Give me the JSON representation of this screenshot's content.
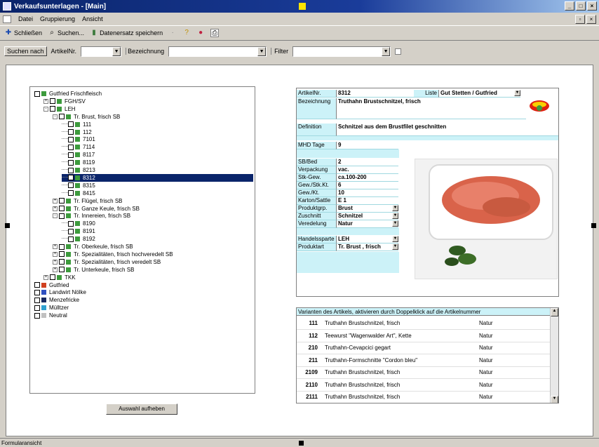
{
  "window": {
    "title": "Verkaufsunterlagen - [Main]"
  },
  "menu": {
    "items": [
      "Datei",
      "Gruppierung",
      "Ansicht"
    ]
  },
  "toolbar": {
    "close": "Schließen",
    "search": "Suchen...",
    "save": "Datenersatz speichern"
  },
  "searchbar": {
    "search_by": "Suchen nach",
    "artnr_label": "ArtikelNr.",
    "artnr_value": "",
    "bez_label": "Bezeichnung",
    "bez_value": "",
    "filter_label": "Filter",
    "filter_value": ""
  },
  "tree": {
    "nodes": [
      {
        "label": "Gutfried Frischfleisch",
        "color": "#3c9a3c",
        "level": 0,
        "expander": ""
      },
      {
        "label": "FGH/SV",
        "color": "#3c9a3c",
        "level": 1,
        "expander": "+"
      },
      {
        "label": "LEH",
        "color": "#3c9a3c",
        "level": 1,
        "expander": "-"
      },
      {
        "label": "Tr. Brust, frisch SB",
        "color": "#3c9a3c",
        "level": 2,
        "expander": "-"
      },
      {
        "label": "111",
        "color": "#3c9a3c",
        "level": 3,
        "expander": ""
      },
      {
        "label": "112",
        "color": "#3c9a3c",
        "level": 3,
        "expander": ""
      },
      {
        "label": "7101",
        "color": "#3c9a3c",
        "level": 3,
        "expander": ""
      },
      {
        "label": "7114",
        "color": "#3c9a3c",
        "level": 3,
        "expander": ""
      },
      {
        "label": "8117",
        "color": "#3c9a3c",
        "level": 3,
        "expander": ""
      },
      {
        "label": "8119",
        "color": "#3c9a3c",
        "level": 3,
        "expander": ""
      },
      {
        "label": "8213",
        "color": "#3c9a3c",
        "level": 3,
        "expander": ""
      },
      {
        "label": "8312",
        "color": "#3c9a3c",
        "level": 3,
        "expander": "",
        "selected": true
      },
      {
        "label": "8315",
        "color": "#3c9a3c",
        "level": 3,
        "expander": ""
      },
      {
        "label": "8415",
        "color": "#3c9a3c",
        "level": 3,
        "expander": ""
      },
      {
        "label": "Tr. Flügel, frisch SB",
        "color": "#3c9a3c",
        "level": 2,
        "expander": "+"
      },
      {
        "label": "Tr. Ganze Keule, frisch SB",
        "color": "#3c9a3c",
        "level": 2,
        "expander": "+"
      },
      {
        "label": "Tr. Innereien, frisch SB",
        "color": "#3c9a3c",
        "level": 2,
        "expander": "-"
      },
      {
        "label": "8190",
        "color": "#3c9a3c",
        "level": 3,
        "expander": ""
      },
      {
        "label": "8191",
        "color": "#3c9a3c",
        "level": 3,
        "expander": ""
      },
      {
        "label": "8192",
        "color": "#3c9a3c",
        "level": 3,
        "expander": ""
      },
      {
        "label": "Tr. Oberkeule, frisch SB",
        "color": "#3c9a3c",
        "level": 2,
        "expander": "+"
      },
      {
        "label": "Tr. Spezialitäten, frisch hochveredelt SB",
        "color": "#3c9a3c",
        "level": 2,
        "expander": "+"
      },
      {
        "label": "Tr. Spezialitäten, frisch veredelt SB",
        "color": "#3c9a3c",
        "level": 2,
        "expander": "+"
      },
      {
        "label": "Tr. Unterkeule, frisch SB",
        "color": "#3c9a3c",
        "level": 2,
        "expander": "+"
      },
      {
        "label": "TKK",
        "color": "#3c9a3c",
        "level": 1,
        "expander": "+"
      },
      {
        "label": "Gutfried",
        "color": "#d04020",
        "level": 0,
        "expander": ""
      },
      {
        "label": "Landwirt Nölke",
        "color": "#3050c0",
        "level": 0,
        "expander": ""
      },
      {
        "label": "Menzefricke",
        "color": "#1a2a60",
        "level": 0,
        "expander": ""
      },
      {
        "label": "Mülltzer",
        "color": "#30a0d0",
        "level": 0,
        "expander": ""
      },
      {
        "label": "Neutral",
        "color": "#c0c0c0",
        "level": 0,
        "expander": ""
      }
    ]
  },
  "clear_selection": "Auswahl aufheben",
  "detail": {
    "artnr_label": "ArtikelNr.",
    "artnr_value": "8312",
    "liste_label": "Liste",
    "liste_value": "Gut Stetten / Gutfried",
    "bez_label": "Bezeichnung",
    "bez_value": "Truthahn Brustschnitzel, frisch",
    "def_label": "Definition",
    "def_value": "Schnitzel aus dem Brustfilet geschnitten",
    "mhd_label": "MHD Tage",
    "mhd_value": "9",
    "sb_label": "SB/Bed",
    "sb_value": "2",
    "verp_label": "Verpackung",
    "verp_value": "vac.",
    "stk_label": "Stk-Gew.",
    "stk_value": "ca.100-200",
    "gew_label": "Gew./Stk.Kt.",
    "gew_value": "6",
    "gewkt_label": "Gew./Kt.",
    "gewkt_value": "10",
    "karton_label": "Karton/Sattle",
    "karton_value": "E 1",
    "prod_label": "Produktgrp.",
    "prod_value": "Brust",
    "zuschnitt_label": "Zuschnitt",
    "zuschnitt_value": "Schnitzel",
    "veredelung_label": "Veredelung",
    "veredelung_value": "Natur",
    "handel_label": "Handelssparte",
    "handel_value": "LEH",
    "produktart_label": "Produktart",
    "produktart_value": "Tr. Brust , frisch"
  },
  "variants": {
    "header": "Varianten des Artikels, aktivieren durch Doppelklick auf die Artikelnummer",
    "rows": [
      {
        "num": "111",
        "name": "Truthahn Brustschnitzel, frisch",
        "ved": "Natur"
      },
      {
        "num": "112",
        "name": "Teewurst \"Wagenwalder Art\", Kette",
        "ved": "Natur"
      },
      {
        "num": "210",
        "name": "Truthahn-Cevapcici gegart",
        "ved": "Natur"
      },
      {
        "num": "211",
        "name": "Truthahn-Formschnitte \"Cordon bleu\"",
        "ved": "Natur"
      },
      {
        "num": "2109",
        "name": "Truthahn Brustschnitzel, frisch",
        "ved": "Natur"
      },
      {
        "num": "2110",
        "name": "Truthahn Brustschnitzel, frisch",
        "ved": "Natur"
      },
      {
        "num": "2111",
        "name": "Truthahn Brustschnitzel, frisch",
        "ved": "Natur"
      }
    ]
  },
  "status": {
    "text": "Formularansicht"
  }
}
